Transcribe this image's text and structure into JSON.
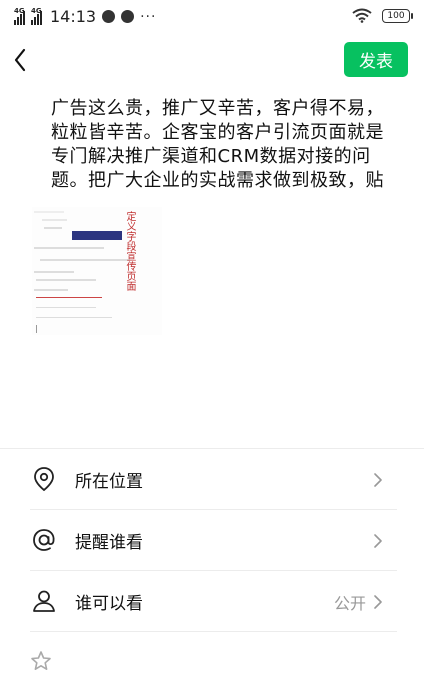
{
  "status_bar": {
    "network1": "4G",
    "network2": "4G",
    "time": "14:13",
    "more": "···",
    "battery": "100"
  },
  "nav": {
    "publish_label": "发表"
  },
  "post": {
    "text": "广告这么贵，推广又辛苦，客户得不易，粒粒皆辛苦。企客宝的客户引流页面就是专门解决推广渠道和CRM数据对接的问题。把广大企业的实战需求做到极致，贴地气，有实",
    "image_overlay_text": "定义字段宣传页面"
  },
  "options": [
    {
      "label": "所在位置",
      "value": "",
      "icon": "location-pin-icon"
    },
    {
      "label": "提醒谁看",
      "value": "",
      "icon": "at-sign-icon"
    },
    {
      "label": "谁可以看",
      "value": "公开",
      "icon": "person-icon"
    }
  ],
  "colors": {
    "accent": "#07c160",
    "text": "#111111",
    "secondary": "#999999",
    "divider": "#ececec"
  }
}
